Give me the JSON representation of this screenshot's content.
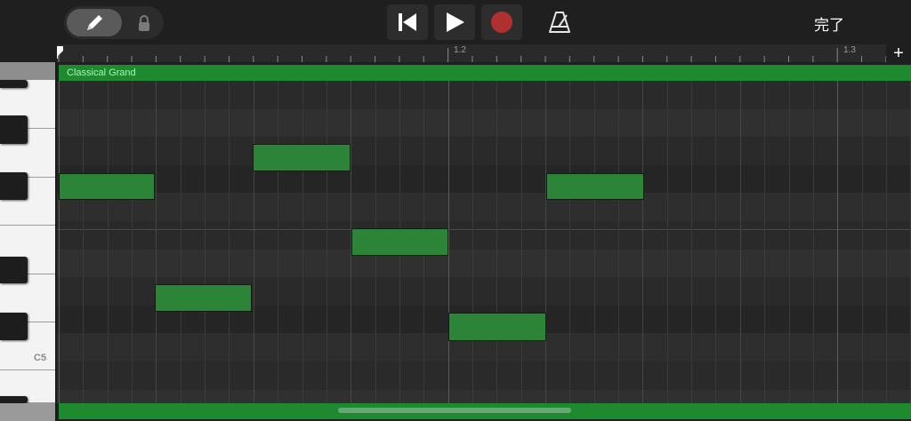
{
  "toolbar": {
    "mode_buttons": [
      {
        "icon": "pencil-icon",
        "selected": true
      },
      {
        "icon": "lock-icon",
        "selected": false
      }
    ],
    "transport": {
      "rewind_icon": "skip-to-start-icon",
      "play_icon": "play-icon",
      "record_icon": "record-icon",
      "record_color": "#b03030"
    },
    "metronome_icon": "metronome-icon",
    "done_label": "完了"
  },
  "ruler": {
    "bar_labels": [
      "1.2",
      "1.3"
    ],
    "add_label": "+"
  },
  "region": {
    "name": "Classical Grand",
    "color": "#1e8a30"
  },
  "keyboard": {
    "octave_label": "C5"
  },
  "notes": [
    {
      "label": "note-1"
    },
    {
      "label": "note-2"
    },
    {
      "label": "note-3"
    },
    {
      "label": "note-4"
    },
    {
      "label": "note-5"
    },
    {
      "label": "note-6"
    }
  ],
  "colors": {
    "note_fill": "#2b8438",
    "background": "#2b2b2b"
  }
}
